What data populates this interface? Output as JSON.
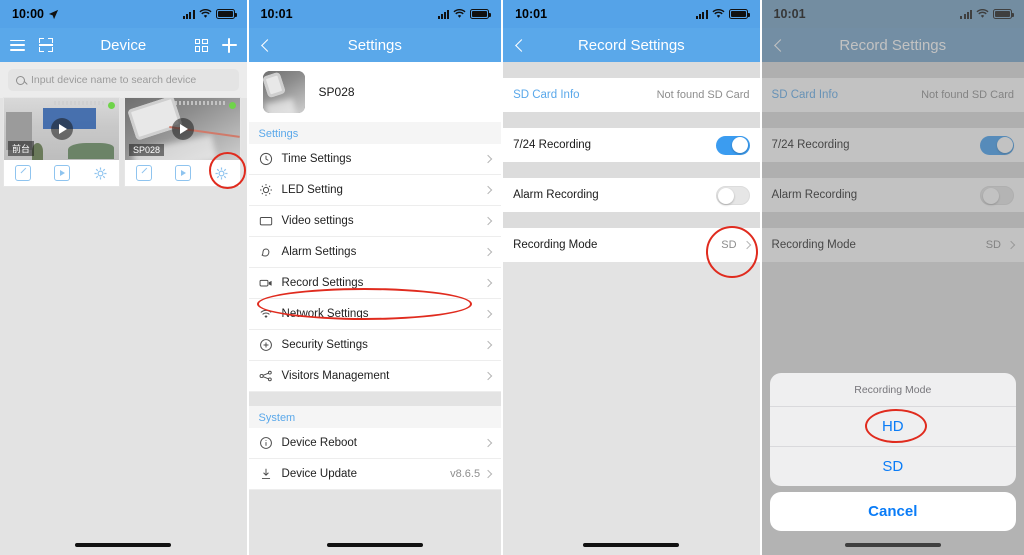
{
  "panels": {
    "device_list": {
      "status": {
        "time": "10:00",
        "location_icon": "location-arrow-icon",
        "signal_icon": "cellular-signal-icon",
        "wifi_icon": "wifi-icon",
        "battery_icon": "battery-icon"
      },
      "nav": {
        "title": "Device",
        "menu_icon": "hamburger-menu-icon",
        "scan_icon": "qr-scan-icon",
        "grid_icon": "grid-view-icon",
        "add_icon": "plus-icon"
      },
      "search": {
        "placeholder": "Input device name to search device",
        "value": "",
        "icon": "search-icon"
      },
      "cards": [
        {
          "label": "前台",
          "status_dot": "online",
          "actions": [
            "edit-icon",
            "playback-icon",
            "settings-gear-icon"
          ]
        },
        {
          "label": "SP028",
          "status_dot": "online",
          "actions": [
            "edit-icon",
            "playback-icon",
            "settings-gear-icon"
          ]
        }
      ]
    },
    "settings": {
      "status": {
        "time": "10:01"
      },
      "nav": {
        "title": "Settings",
        "back_icon": "back-chevron-icon"
      },
      "device": {
        "name": "SP028"
      },
      "group_settings_label": "Settings",
      "items": [
        {
          "label": "Time Settings",
          "icon": "clock-icon",
          "value": ""
        },
        {
          "label": "LED Setting",
          "icon": "lightbulb-icon",
          "value": ""
        },
        {
          "label": "Video settings",
          "icon": "video-frame-icon",
          "value": ""
        },
        {
          "label": "Alarm Settings",
          "icon": "bell-icon",
          "value": ""
        },
        {
          "label": "Record Settings",
          "icon": "camcorder-icon",
          "value": ""
        },
        {
          "label": "Network Settings",
          "icon": "wifi-icon",
          "value": ""
        },
        {
          "label": "Security Settings",
          "icon": "shield-plus-icon",
          "value": ""
        },
        {
          "label": "Visitors Management",
          "icon": "share-nodes-icon",
          "value": ""
        }
      ],
      "group_system_label": "System",
      "system_items": [
        {
          "label": "Device Reboot",
          "icon": "info-circle-icon",
          "value": ""
        },
        {
          "label": "Device Update",
          "icon": "download-icon",
          "value": "v8.6.5"
        }
      ]
    },
    "record_settings": {
      "status": {
        "time": "10:01"
      },
      "nav": {
        "title": "Record Settings",
        "back_icon": "back-chevron-icon"
      },
      "sd_card": {
        "label": "SD Card Info",
        "value": "Not found SD Card"
      },
      "toggles": [
        {
          "label": "7/24 Recording",
          "state": "on"
        },
        {
          "label": "Alarm Recording",
          "state": "off"
        }
      ],
      "recording_mode": {
        "label": "Recording Mode",
        "value": "SD"
      }
    },
    "record_settings_sheet": {
      "status": {
        "time": "10:01"
      },
      "nav": {
        "title": "Record Settings",
        "back_icon": "back-chevron-icon"
      },
      "sd_card": {
        "label": "SD Card Info",
        "value": "Not found SD Card"
      },
      "toggles": [
        {
          "label": "7/24 Recording",
          "state": "on"
        },
        {
          "label": "Alarm Recording",
          "state": "off"
        }
      ],
      "recording_mode": {
        "label": "Recording Mode",
        "value": "SD"
      },
      "sheet": {
        "title": "Recording Mode",
        "options": [
          "HD",
          "SD"
        ],
        "cancel": "Cancel"
      }
    }
  },
  "annotation_color": "#e02b1e"
}
